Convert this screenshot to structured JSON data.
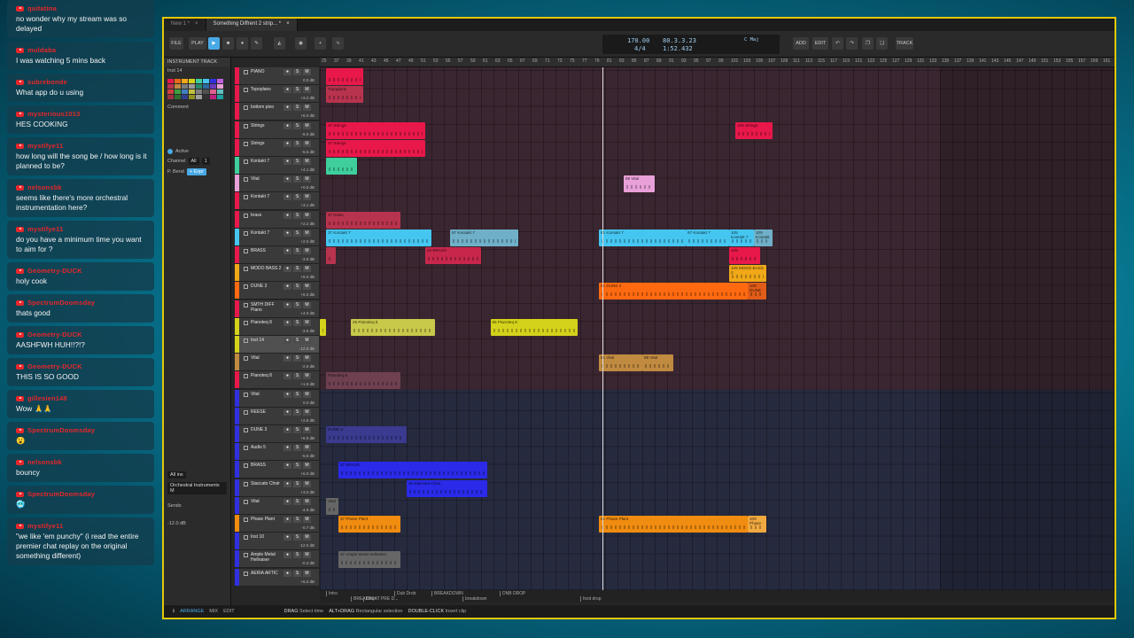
{
  "chat": [
    {
      "user": "quitatina",
      "text": "no wonder why my stream was so delayed"
    },
    {
      "user": "muldaba",
      "text": "I was watching 5 mins back"
    },
    {
      "user": "subrebonde",
      "text": "What app do u using"
    },
    {
      "user": "mysterious1013",
      "text": "HES COOKING"
    },
    {
      "user": "mystifye11",
      "text": "how long will the song be / how long is it planned to be?"
    },
    {
      "user": "nelsonsbk",
      "text": "seems like there's more orchestral instrumentation here?"
    },
    {
      "user": "mystifye11",
      "text": "do you have a minimum time you want to aim for ?"
    },
    {
      "user": "Geometry-DUCK",
      "text": "holy cook"
    },
    {
      "user": "SpectrumDoomsday",
      "text": "thats good"
    },
    {
      "user": "Geometry-DUCK",
      "text": "AASHFWH HUH!!?!?"
    },
    {
      "user": "Geometry-DUCK",
      "text": "THIS IS SO GOOD"
    },
    {
      "user": "gillesien148",
      "text": "Wow 🙏🙏"
    },
    {
      "user": "SpectrumDoomsday",
      "text": "😮"
    },
    {
      "user": "nelsonsbk",
      "text": "bouncy"
    },
    {
      "user": "SpectrumDoomsday",
      "text": "🥶"
    },
    {
      "user": "mystifye11",
      "text": "\"we like 'em punchy\" (i read the entire premier chat replay on the original something different)"
    }
  ],
  "daw": {
    "tabs": [
      {
        "label": "New 1 *"
      },
      {
        "label": "Something Diffrent 2 strip... *"
      }
    ],
    "toolbar": {
      "file": "FILE",
      "play": "PLAY",
      "add": "ADD",
      "edit": "EDIT",
      "track": "TRACK"
    },
    "display": {
      "tempo": "170.00",
      "signature": "4/4",
      "position": "80.3.3.23",
      "time": "1:52.432",
      "key": "C Maj"
    },
    "inspector": {
      "header": "INSTRUMENT TRACK",
      "track_name": "Inst 14",
      "comment": "Comment",
      "active": "Active",
      "channel_label": "Channel",
      "channel_val": "All",
      "channel_num": "1",
      "pbend_label": "P. Bend",
      "pbend_val": "+ Expr",
      "all_ins": "All ins",
      "device": "Orchestral Instruments M",
      "sends": "Sends",
      "vol": "-12.0 dB"
    },
    "tracks": [
      {
        "name": "PIANO",
        "db": "0.0 dB",
        "color": "#e8184a"
      },
      {
        "name": "Topoplans",
        "db": "+3.2 dB",
        "color": "#e8184a"
      },
      {
        "name": "bottom pino",
        "db": "+6.0 dB",
        "color": "#e8184a"
      },
      {
        "name": "Strings",
        "db": "-5.0 dB",
        "color": "#e8184a"
      },
      {
        "name": "Strings",
        "db": "-5.5 dB",
        "color": "#e8184a"
      },
      {
        "name": "Kontakt 7",
        "db": "+4.1 dB",
        "color": "#3ecf9c"
      },
      {
        "name": "Vital",
        "db": "+0.5 dB",
        "color": "#e8a0d8"
      },
      {
        "name": "Kontakt 7",
        "db": "+3.1 dB",
        "color": "#e8184a"
      },
      {
        "name": "brass",
        "db": "+2.2 dB",
        "color": "#e8184a"
      },
      {
        "name": "Kontakt 7",
        "db": "+2.0 dB",
        "color": "#45c6f0"
      },
      {
        "name": "BRASS",
        "db": "-3.9 dB",
        "color": "#e8184a"
      },
      {
        "name": "MODO BASS 2",
        "db": "+6.0 dB",
        "color": "#f0a818"
      },
      {
        "name": "DUNE 3",
        "db": "+6.0 dB",
        "color": "#ff6a10"
      },
      {
        "name": "SMTH DIFF Piano",
        "db": "+4.0 dB",
        "color": "#e8184a"
      },
      {
        "name": "Pianoteq 8",
        "db": "-3.9 dB",
        "color": "#d4d21a"
      },
      {
        "name": "Inst 14",
        "db": "-12.0 dB",
        "color": "#d4d21a"
      },
      {
        "name": "Vital",
        "db": "-2.6 dB",
        "color": "#c08a40"
      },
      {
        "name": "Pianoteq 8",
        "db": "+1.8 dB",
        "color": "#e8184a"
      },
      {
        "name": "Vital",
        "db": "0.0 dB",
        "color": "#3030e0"
      },
      {
        "name": "REESE",
        "db": "+2.8 dB",
        "color": "#3030e0"
      },
      {
        "name": "DUNE 3",
        "db": "+6.0 dB",
        "color": "#3030e0"
      },
      {
        "name": "Audio 5",
        "db": "-5.5 dB",
        "color": "#3030e0"
      },
      {
        "name": "BRASS",
        "db": "+6.0 dB",
        "color": "#3030e0"
      },
      {
        "name": "Staccato Choir",
        "db": "+3.0 dB",
        "color": "#3030e0"
      },
      {
        "name": "Vital",
        "db": "-4.9 dB",
        "color": "#3030e0"
      },
      {
        "name": "Phase Plant",
        "db": "-0.7 dB",
        "color": "#f08c10"
      },
      {
        "name": "Inst 10",
        "db": "-12.0 dB",
        "color": "#3030e0"
      },
      {
        "name": "Ample Metal Hellraiser",
        "db": "-0.3 dB",
        "color": "#3030e0"
      },
      {
        "name": "AERIA ARTIC",
        "db": "+6.0 dB",
        "color": "#3030e0"
      }
    ],
    "ruler": [
      "25",
      "37",
      "39",
      "41",
      "43",
      "45",
      "47",
      "49",
      "51",
      "53",
      "55",
      "57",
      "59",
      "61",
      "63",
      "65",
      "67",
      "69",
      "71",
      "73",
      "75",
      "77",
      "79",
      "81",
      "83",
      "85",
      "87",
      "89",
      "91",
      "93",
      "95",
      "97",
      "99",
      "101",
      "103",
      "105",
      "107",
      "109",
      "111",
      "113",
      "115",
      "117",
      "119",
      "121",
      "123",
      "125",
      "127",
      "129",
      "131",
      "133",
      "135",
      "137",
      "139",
      "141",
      "143",
      "145",
      "147",
      "149",
      "151",
      "153",
      "155",
      "157",
      "159",
      "161"
    ],
    "clips": [
      {
        "label": "",
        "track": 0,
        "bar": 37,
        "len": 12,
        "color": "#e8184a"
      },
      {
        "label": "Topoplans",
        "track": 1,
        "bar": 37,
        "len": 12,
        "color": "#b8334e"
      },
      {
        "label": "37 Strings",
        "track": 3,
        "bar": 37,
        "len": 32,
        "color": "#e8184a"
      },
      {
        "label": "37 Strings",
        "track": 4,
        "bar": 37,
        "len": 32,
        "color": "#e8184a"
      },
      {
        "label": "109 Strings",
        "track": 3,
        "bar": 169,
        "len": 12,
        "color": "#e8184a"
      },
      {
        "label": "",
        "track": 5,
        "bar": 37,
        "len": 10,
        "color": "#3ecf9c"
      },
      {
        "label": "89 Vital",
        "track": 6,
        "bar": 133,
        "len": 10,
        "color": "#e8a0d8"
      },
      {
        "label": "37 brass",
        "track": 8,
        "bar": 37,
        "len": 24,
        "color": "#b8334e"
      },
      {
        "label": "37 Kontakt 7",
        "track": 9,
        "bar": 37,
        "len": 34,
        "color": "#45c6f0"
      },
      {
        "label": "57 Kontakt 7",
        "track": 9,
        "bar": 77,
        "len": 22,
        "color": "#6fb0c8"
      },
      {
        "label": "81 Kontakt 7",
        "track": 9,
        "bar": 125,
        "len": 28,
        "color": "#45c6f0"
      },
      {
        "label": "97 Kontakt 7",
        "track": 9,
        "bar": 153,
        "len": 14,
        "color": "#45c6f0"
      },
      {
        "label": "105 Kontakt 7",
        "track": 9,
        "bar": 167,
        "len": 8,
        "color": "#45c6f0"
      },
      {
        "label": "109 Kontakt",
        "track": 9,
        "bar": 175,
        "len": 6,
        "color": "#6fb0c8"
      },
      {
        "label": "",
        "track": 10,
        "bar": 37,
        "len": 3,
        "color": "#b8334e"
      },
      {
        "label": "52 BRASS",
        "track": 10,
        "bar": 69,
        "len": 18,
        "color": "#c8274c"
      },
      {
        "label": "105",
        "track": 10,
        "bar": 167,
        "len": 10,
        "color": "#e8184a"
      },
      {
        "label": "105 MODO BASS 2",
        "track": 11,
        "bar": 167,
        "len": 12,
        "color": "#f0a818"
      },
      {
        "label": "81 DUNE 3",
        "track": 12,
        "bar": 125,
        "len": 48,
        "color": "#ff6a10"
      },
      {
        "label": "109 DUNE",
        "track": 12,
        "bar": 173,
        "len": 6,
        "color": "#e05c18"
      },
      {
        "label": "29 Pianoteq 8",
        "track": 14,
        "bar": 45,
        "len": 27,
        "color": "#c8c84a"
      },
      {
        "label": "65 Pianoteq 8",
        "track": 14,
        "bar": 90,
        "len": 28,
        "color": "#d4d21a"
      },
      {
        "label": "",
        "track": 14,
        "bar": 35,
        "len": 2,
        "color": "#d4d21a"
      },
      {
        "label": "81 Vital",
        "track": 16,
        "bar": 125,
        "len": 14,
        "color": "#c08a40"
      },
      {
        "label": "89 Vital",
        "track": 16,
        "bar": 139,
        "len": 10,
        "color": "#c08a40"
      },
      {
        "label": "Pianoteq 8",
        "track": 17,
        "bar": 37,
        "len": 24,
        "color": "#6e4050"
      },
      {
        "label": "DUNE 3",
        "track": 20,
        "bar": 37,
        "len": 26,
        "color": "#3a3a8e"
      },
      {
        "label": "37 BRASS",
        "track": 22,
        "bar": 41,
        "len": 48,
        "color": "#2a2ae8"
      },
      {
        "label": "49 Staccato Choir",
        "track": 23,
        "bar": 63,
        "len": 26,
        "color": "#2a2ae8"
      },
      {
        "label": "Vital",
        "track": 24,
        "bar": 37,
        "len": 4,
        "color": "#666"
      },
      {
        "label": "37 Phase Plant",
        "track": 25,
        "bar": 41,
        "len": 20,
        "color": "#f08c10"
      },
      {
        "label": "81 Phase Plant",
        "track": 25,
        "bar": 125,
        "len": 48,
        "color": "#f08c10"
      },
      {
        "label": "109 Phase",
        "track": 25,
        "bar": 173,
        "len": 6,
        "color": "#f0a840"
      },
      {
        "label": "37 Ample Metal Hellraiser",
        "track": 27,
        "bar": 41,
        "len": 20,
        "color": "#666"
      }
    ],
    "cues": [
      {
        "label": "Intro",
        "bar": 37
      },
      {
        "label": "BREAKBEAT PRE D...",
        "bar": 45
      },
      {
        "label": "Dub Drob",
        "bar": 59
      },
      {
        "label": "Drop",
        "bar": 49
      },
      {
        "label": "BREAKDOWN",
        "bar": 71
      },
      {
        "label": "breakdown",
        "bar": 81
      },
      {
        "label": "DNB DROP",
        "bar": 93
      },
      {
        "label": "foxit drop",
        "bar": 119
      }
    ],
    "status": {
      "arrange": "ARRANGE",
      "mix": "MIX",
      "edit": "EDIT",
      "drag": "DRAG",
      "drag_desc": "Select time",
      "altdrag": "ALT+DRAG",
      "altdrag_desc": "Rectangular selection",
      "dbl": "DOUBLE-CLICK",
      "dbl_desc": "Insert clip"
    }
  }
}
